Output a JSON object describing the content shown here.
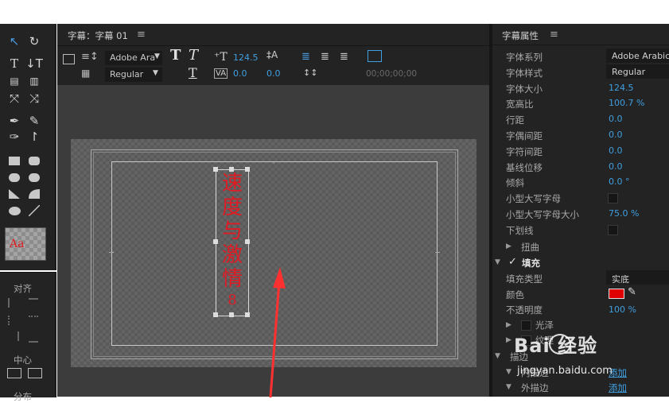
{
  "title_panel": {
    "tab_label": "字幕：字幕 01",
    "menu_glyph": "≡",
    "font_family": "Adobe Ara",
    "font_style": "Regular",
    "font_size": "124.5",
    "kerning": "0.0",
    "leading": "0.0",
    "timecode": "00;00;00;00"
  },
  "tools": {
    "style_preview": "Aa"
  },
  "align_panel": {
    "align_label": "对齐",
    "center_label": "中心",
    "distribute_label": "分布"
  },
  "canvas": {
    "vertical_text": [
      "速",
      "度",
      "与",
      "激",
      "情"
    ],
    "number_text": "8",
    "text_color": "#e01b24"
  },
  "properties": {
    "header": "字幕属性",
    "menu_glyph": "≡",
    "rows": [
      {
        "label": "字体系列",
        "value": "Adobe Arabic",
        "kind": "plain"
      },
      {
        "label": "字体样式",
        "value": "Regular",
        "kind": "plain"
      },
      {
        "label": "字体大小",
        "value": "124.5",
        "kind": "blue"
      },
      {
        "label": "宽高比",
        "value": "100.7 %",
        "kind": "blue"
      },
      {
        "label": "行距",
        "value": "0.0",
        "kind": "blue"
      },
      {
        "label": "字偶间距",
        "value": "0.0",
        "kind": "blue"
      },
      {
        "label": "字符间距",
        "value": "0.0",
        "kind": "blue"
      },
      {
        "label": "基线位移",
        "value": "0.0",
        "kind": "blue"
      },
      {
        "label": "倾斜",
        "value": "0.0 °",
        "kind": "blue"
      },
      {
        "label": "小型大写字母",
        "value": "",
        "kind": "check"
      },
      {
        "label": "小型大写字母大小",
        "value": "75.0 %",
        "kind": "blue"
      },
      {
        "label": "下划线",
        "value": "",
        "kind": "check"
      }
    ],
    "distort_label": "扭曲",
    "fill_label": "填充",
    "fill_type_label": "填充类型",
    "fill_type_value": "实底",
    "color_label": "颜色",
    "fill_color": "#e00000",
    "opacity_label": "不透明度",
    "opacity_value": "100 %",
    "sheen_label": "光泽",
    "texture_label": "纹理",
    "stroke_label": "描边",
    "inner_stroke_label": "内描边",
    "outer_stroke_label": "外描边",
    "add_label": "添加",
    "add_label2": "添加"
  },
  "watermark": {
    "brand": "Bai  经验",
    "url": "jingyan.baidu.com"
  }
}
